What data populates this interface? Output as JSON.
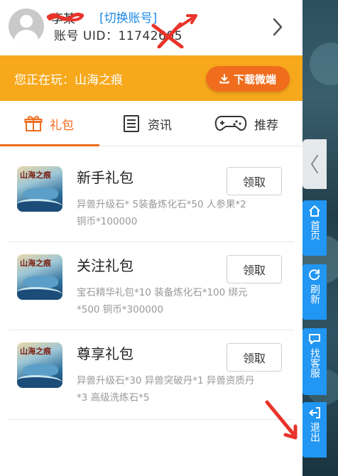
{
  "header": {
    "username": "李某",
    "switch_account": "[切换账号]",
    "uid_label": "账号 UID：",
    "uid_value": "11742605"
  },
  "banner": {
    "now_playing": "您正在玩：山海之痕",
    "download_label": "下载微端"
  },
  "tabs": [
    {
      "label": "礼包",
      "icon": "gift-icon",
      "active": true
    },
    {
      "label": "资讯",
      "icon": "news-icon",
      "active": false
    },
    {
      "label": "推荐",
      "icon": "gamepad-icon",
      "active": false
    }
  ],
  "gifts": [
    {
      "title": "新手礼包",
      "desc": "异兽升级石* 5装备炼化石*50 人参果*2 铜币*100000",
      "button": "领取",
      "icon_text": "山海之痕"
    },
    {
      "title": "关注礼包",
      "desc": "宝石精华礼包*10 装备炼化石*100 绑元*500 铜币*300000",
      "button": "领取",
      "icon_text": "山海之痕"
    },
    {
      "title": "尊享礼包",
      "desc": "异兽升级石*30 异兽突破丹*1 异兽资质丹*3 高级洗练石*5",
      "button": "领取",
      "icon_text": "山海之痕"
    }
  ],
  "side_menu": [
    {
      "label": "首页",
      "icon": "home-icon"
    },
    {
      "label": "刷新",
      "icon": "refresh-icon"
    },
    {
      "label": "找客服",
      "icon": "chat-icon"
    },
    {
      "label": "退出",
      "icon": "exit-icon"
    }
  ],
  "colors": {
    "accent_orange": "#f06d1e",
    "banner_yellow": "#f7a81b",
    "side_blue": "#2196f3",
    "link_blue": "#1e88e5"
  }
}
